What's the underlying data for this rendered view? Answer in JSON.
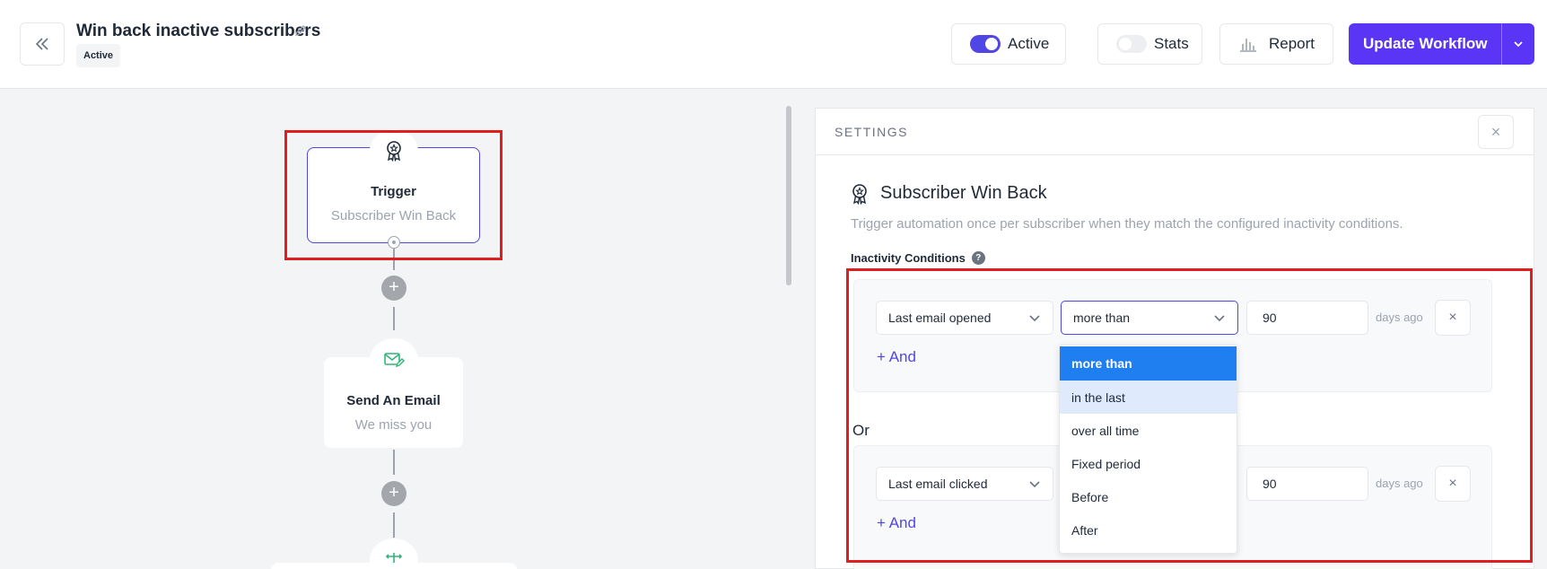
{
  "header": {
    "workflow_title": "Win back inactive subscribers",
    "status_badge": "Active",
    "active_toggle_label": "Active",
    "active_toggle_on": true,
    "stats_toggle_label": "Stats",
    "stats_toggle_on": false,
    "report_label": "Report",
    "update_label": "Update Workflow"
  },
  "canvas": {
    "trigger_node": {
      "title": "Trigger",
      "subtitle": "Subscriber Win Back",
      "icon": "award-icon"
    },
    "email_node": {
      "title": "Send An Email",
      "subtitle": "We miss you",
      "icon": "mail-edit-icon"
    },
    "add_step_label": "+",
    "next_node_icon": "split-icon"
  },
  "settings": {
    "header_label": "SETTINGS",
    "close_label": "×",
    "title": "Subscriber Win Back",
    "description": "Trigger automation once per subscriber when they match the configured inactivity conditions.",
    "conditions_label": "Inactivity Conditions",
    "help_label": "?",
    "or_label": "Or",
    "and_label": "+ And",
    "remove_label": "×",
    "groups": [
      {
        "field": "Last email opened",
        "operator": "more than",
        "value": "90",
        "suffix": "days ago"
      },
      {
        "field": "Last email clicked",
        "operator": "",
        "value": "90",
        "suffix": "days ago"
      }
    ],
    "operator_options": [
      "more than",
      "in the last",
      "over all time",
      "Fixed period",
      "Before",
      "After"
    ],
    "selected_option": "more than",
    "hovered_option": "in the last"
  },
  "colors": {
    "accent": "#5b35f5",
    "highlight_box": "#e01e1e",
    "menu_selected": "#1f7ef0"
  }
}
